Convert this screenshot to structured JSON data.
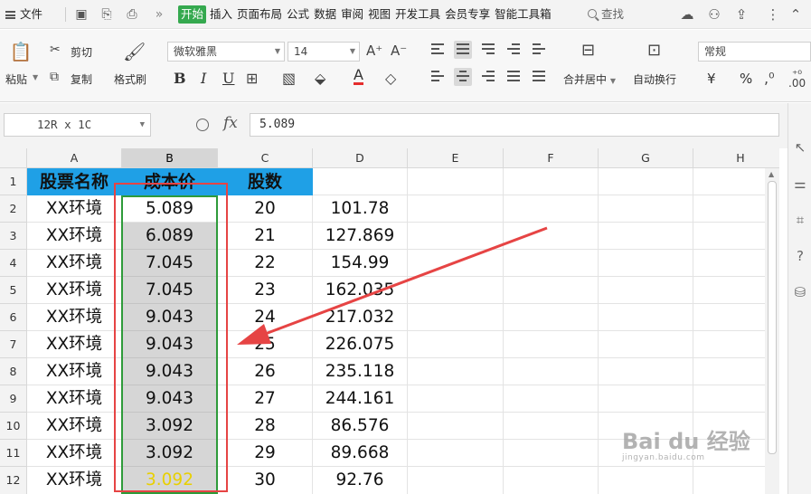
{
  "menubar": {
    "file": "文件",
    "tabs": [
      "开始",
      "插入",
      "页面布局",
      "公式",
      "数据",
      "审阅",
      "视图",
      "开发工具",
      "会员专享",
      "智能工具箱"
    ],
    "search": "查找"
  },
  "ribbon": {
    "paste": "粘贴",
    "cut": "剪切",
    "copy": "复制",
    "format_painter": "格式刷",
    "font_name": "微软雅黑",
    "font_size": "14",
    "bold": "B",
    "italic": "I",
    "underline": "U",
    "merge_center": "合并居中",
    "wrap_text": "自动换行",
    "number_format": "常规",
    "currency": "¥",
    "percent": "%"
  },
  "formula_bar": {
    "name_box": "12R x 1C",
    "fx": "fx",
    "value": "5.089"
  },
  "grid": {
    "columns": [
      "A",
      "B",
      "C",
      "D",
      "E",
      "F",
      "G",
      "H"
    ],
    "rows": [
      "1",
      "2",
      "3",
      "4",
      "5",
      "6",
      "7",
      "8",
      "9",
      "10",
      "11",
      "12"
    ],
    "header_row": [
      "股票名称",
      "成本价",
      "股数",
      ""
    ],
    "data": [
      [
        "XX环境",
        "5.089",
        "20",
        "101.78"
      ],
      [
        "XX环境",
        "6.089",
        "21",
        "127.869"
      ],
      [
        "XX环境",
        "7.045",
        "22",
        "154.99"
      ],
      [
        "XX环境",
        "7.045",
        "23",
        "162.035"
      ],
      [
        "XX环境",
        "9.043",
        "24",
        "217.032"
      ],
      [
        "XX环境",
        "9.043",
        "25",
        "226.075"
      ],
      [
        "XX环境",
        "9.043",
        "26",
        "235.118"
      ],
      [
        "XX环境",
        "9.043",
        "27",
        "244.161"
      ],
      [
        "XX环境",
        "3.092",
        "28",
        "86.576"
      ],
      [
        "XX环境",
        "3.092",
        "29",
        "89.668"
      ],
      [
        "XX环境",
        "3.092",
        "30",
        "92.76"
      ]
    ]
  },
  "watermark": {
    "brand": "Bai du 经验",
    "url": "jingyan.baidu.com"
  },
  "colors": {
    "accent_tab": "#35a94f",
    "header_fill": "#1fa0e6",
    "selection": "#2e9b3a",
    "annotation": "#e64444"
  }
}
